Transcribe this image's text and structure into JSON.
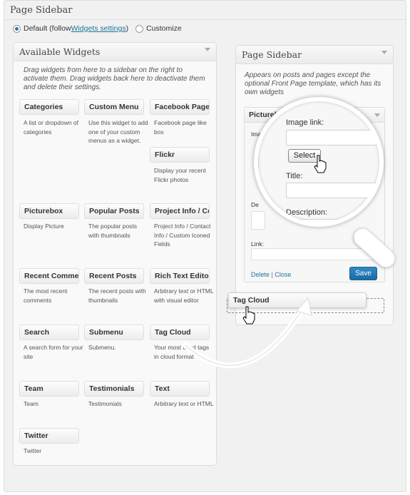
{
  "page": {
    "title": "Page Sidebar"
  },
  "options": {
    "default_prefix": "Default (follow ",
    "default_link": "Widgets settings",
    "default_suffix": ")",
    "customize": "Customize"
  },
  "available": {
    "title": "Available Widgets",
    "description": "Drag widgets from here to a sidebar on the right to activate them. Drag widgets back here to deactivate them and delete their settings.",
    "widgets": [
      {
        "name": "Categories",
        "desc": "A list or dropdown of categories"
      },
      {
        "name": "Custom Menu",
        "desc": "Use this widget to add one of your custom menus as a widget."
      },
      {
        "name": "Facebook Page",
        "desc": "Facebook page like box"
      },
      {
        "name": "Flickr",
        "desc": "Display your recent Flickr photos"
      },
      {
        "name": "Picturebox",
        "desc": "Display Picture"
      },
      {
        "name": "Popular Posts",
        "desc": "The popular posts with thumbnails"
      },
      {
        "name": "Project Info / Co",
        "desc": "Project Info / Contact Info / Custom Iconed Fields"
      },
      {
        "name": "Recent Comme",
        "desc": "The most recent comments"
      },
      {
        "name": "Recent Posts",
        "desc": "The recent posts with thumbnails"
      },
      {
        "name": "Rich Text Editor",
        "desc": "Arbitrary text or HTML with visual editor"
      },
      {
        "name": "Search",
        "desc": "A search form for your site"
      },
      {
        "name": "Submenu",
        "desc": "Submenu."
      },
      {
        "name": "Tag Cloud",
        "desc": "Your most used tags in cloud format"
      },
      {
        "name": "Team",
        "desc": "Team"
      },
      {
        "name": "Testimonials",
        "desc": "Testimonials"
      },
      {
        "name": "Text",
        "desc": "Arbitrary text or HTML"
      },
      {
        "name": "Twitter",
        "desc": "Twitter"
      }
    ]
  },
  "sidebar": {
    "title": "Page Sidebar",
    "description": "Appears on posts and pages except the optional Front Page template, which has its own widgets",
    "picturebox": {
      "title": "Picturebox",
      "image_label_short": "Imag",
      "de_label_short": "De",
      "link_label": "Link:",
      "delete": "Delete",
      "separator": "|",
      "close": "Close",
      "save": "Save"
    },
    "dragging": "Tag Cloud"
  },
  "zoom": {
    "image_link": "Image link:",
    "select": "Select",
    "title": "Title:",
    "description": "Description:"
  },
  "icons": [
    "radio-on-icon",
    "radio-off-icon",
    "caret-down-icon",
    "hand-cursor-icon",
    "magnifier-icon",
    "curved-arrow-icon"
  ],
  "colors": {
    "link": "#21759b",
    "save_button": "#2285c3",
    "frame": "#f1f1f1"
  }
}
